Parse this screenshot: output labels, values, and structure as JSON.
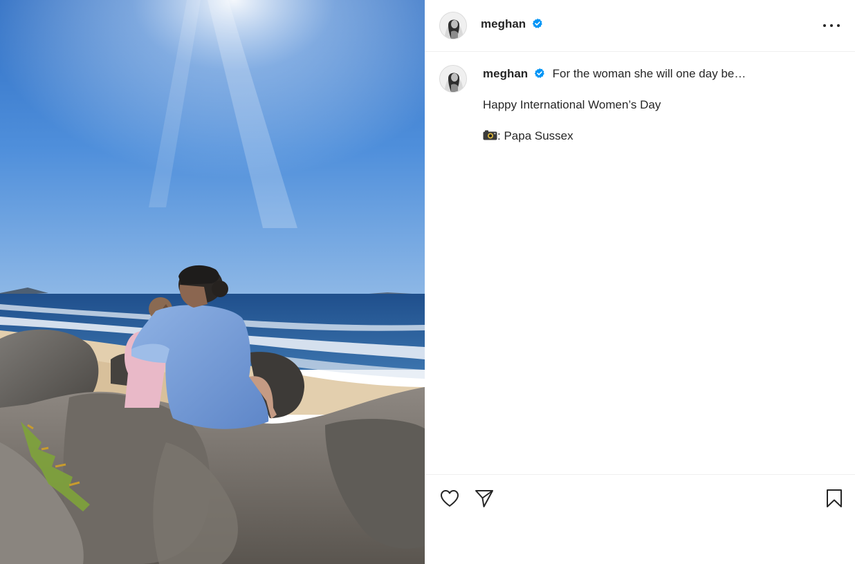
{
  "post": {
    "username": "meghan",
    "verified": true,
    "caption_line_1": "For the woman she will one day be…",
    "caption_line_2": "Happy International Women’s Day",
    "caption_line_3": ": Papa Sussex"
  },
  "icons": {
    "verified": "verified-badge-icon",
    "more": "more-options-icon",
    "like": "heart-icon",
    "share": "send-icon",
    "save": "bookmark-icon",
    "camera": "camera-emoji-icon"
  },
  "colors": {
    "verified_badge": "#0095f6",
    "text": "#262626",
    "divider": "#efefef"
  }
}
